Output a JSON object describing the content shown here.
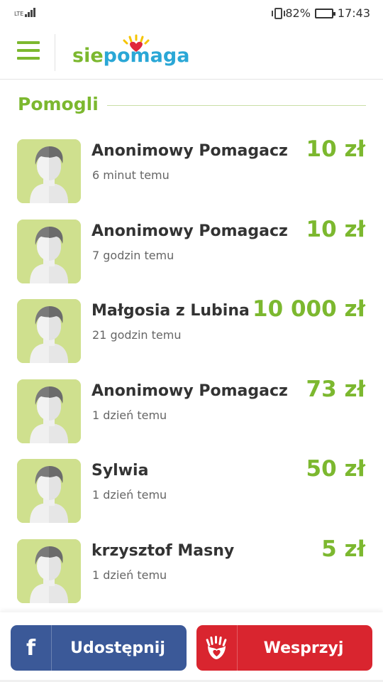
{
  "status_bar": {
    "network": "LTE",
    "battery_percent": "82%",
    "battery_level": 0.82,
    "time": "17:43"
  },
  "header": {
    "menu_icon": "hamburger-menu-icon",
    "logo": {
      "part1": "sie",
      "part2": "po",
      "part3": "maga"
    }
  },
  "section": {
    "title": "Pomogli"
  },
  "donors": [
    {
      "name": "Anonimowy Pomagacz",
      "time": "6 minut temu",
      "amount": "10 zł"
    },
    {
      "name": "Anonimowy Pomagacz",
      "time": "7 godzin temu",
      "amount": "10 zł"
    },
    {
      "name": "Małgosia z Lubina",
      "time": "21 godzin temu",
      "amount": "10 000 zł"
    },
    {
      "name": "Anonimowy Pomagacz",
      "time": "1 dzień temu",
      "amount": "73 zł"
    },
    {
      "name": "Sylwia",
      "time": "1 dzień temu",
      "amount": "50 zł"
    },
    {
      "name": "krzysztof Masny",
      "time": "1 dzień temu",
      "amount": "5 zł"
    }
  ],
  "actions": {
    "share_label": "Udostępnij",
    "share_icon": "facebook-icon",
    "support_label": "Wesprzyj",
    "support_icon": "hands-heart-icon"
  },
  "colors": {
    "accent_green": "#7cb82f",
    "facebook_blue": "#3b5998",
    "support_red": "#d9252f",
    "avatar_bg": "#cfe08e"
  }
}
